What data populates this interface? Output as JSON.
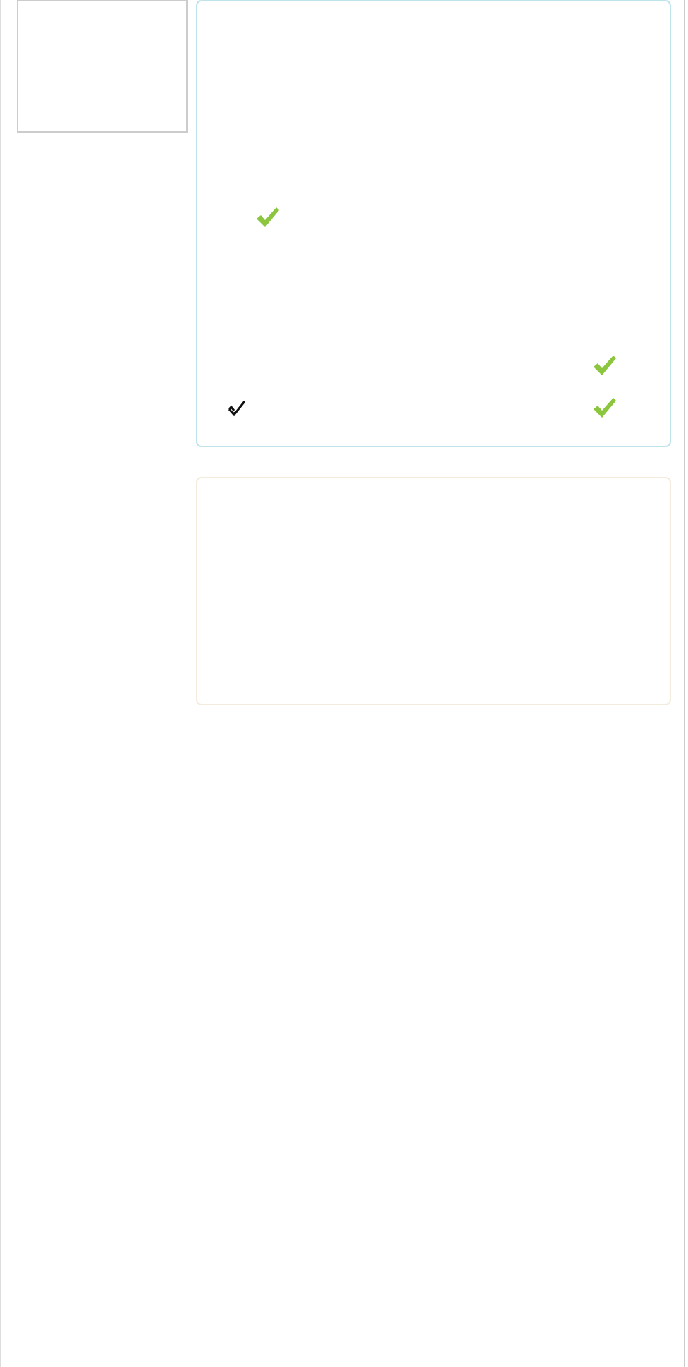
{
  "sidebar": {
    "kind": "box"
  },
  "panels": [
    {
      "kind": "info",
      "rows": [
        {
          "left": {
            "kind": "green"
          }
        },
        {
          "right": {
            "kind": "green"
          }
        },
        {
          "left": {
            "kind": "outline"
          },
          "right": {
            "kind": "green"
          }
        }
      ]
    },
    {
      "kind": "warning"
    }
  ]
}
